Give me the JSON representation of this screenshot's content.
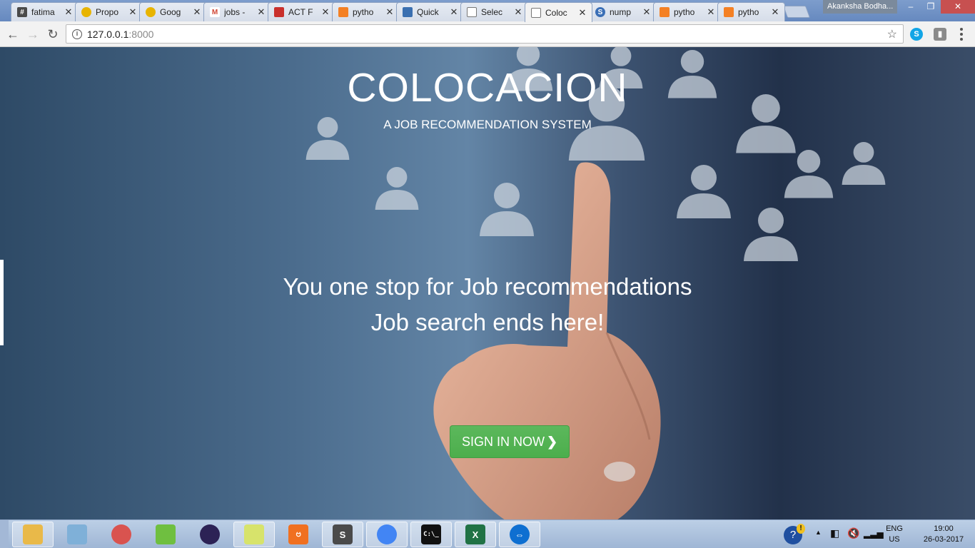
{
  "browser": {
    "tabs": [
      {
        "title": "fatima",
        "icon": "hash-icon",
        "color": "#4a4a4a"
      },
      {
        "title": "Propo",
        "icon": "coin-icon",
        "color": "#e8b400"
      },
      {
        "title": "Goog",
        "icon": "coin-icon",
        "color": "#e8b400"
      },
      {
        "title": "jobs -",
        "icon": "gmail-icon",
        "color": "#d14836"
      },
      {
        "title": "ACT F",
        "icon": "act-icon",
        "color": "#c9302c"
      },
      {
        "title": "pytho",
        "icon": "stack-icon",
        "color": "#f48024"
      },
      {
        "title": "Quick",
        "icon": "chart-icon",
        "color": "#3a6fb0"
      },
      {
        "title": "Selec",
        "icon": "page-icon",
        "color": "#777777"
      },
      {
        "title": "Coloc",
        "icon": "page-icon",
        "color": "#777777"
      },
      {
        "title": "nump",
        "icon": "s-icon",
        "color": "#3b6fb6"
      },
      {
        "title": "pytho",
        "icon": "stack-icon",
        "color": "#f48024"
      },
      {
        "title": "pytho",
        "icon": "stack-icon",
        "color": "#f48024"
      }
    ],
    "profile_name": "Akanksha Bodha...",
    "url_host": "127.0.0.1",
    "url_port": ":8000"
  },
  "page": {
    "brand": "COLOCACION",
    "tagline": "A JOB RECOMMENDATION SYSTEM",
    "headline_line1": "You one stop for Job recommendations",
    "headline_line2": "Job search ends here!",
    "signin_label": "SIGN IN NOW",
    "accent_color": "#5cb85c"
  },
  "taskbar": {
    "apps": [
      {
        "name": "explorer",
        "icon": "folder-icon",
        "color": "#e9b949",
        "glyph": ""
      },
      {
        "name": "notepad",
        "icon": "notepad-icon",
        "color": "#7fb0d8",
        "glyph": ""
      },
      {
        "name": "spinner",
        "icon": "spinner-icon",
        "color": "#d9534f",
        "glyph": ""
      },
      {
        "name": "notepadpp",
        "icon": "notepadpp-icon",
        "color": "#6fbf40",
        "glyph": ""
      },
      {
        "name": "eclipse",
        "icon": "eclipse-icon",
        "color": "#2c2255",
        "glyph": ""
      },
      {
        "name": "stickynotes",
        "icon": "stickynotes-icon",
        "color": "#d7e36b",
        "glyph": ""
      },
      {
        "name": "xampp",
        "icon": "xampp-icon",
        "color": "#f07020",
        "glyph": "ဗ"
      },
      {
        "name": "sublime",
        "icon": "sublime-icon",
        "color": "#4a4a4a",
        "glyph": "S"
      },
      {
        "name": "chrome",
        "icon": "chrome-icon",
        "color": "#4285f4",
        "glyph": ""
      },
      {
        "name": "cmd",
        "icon": "cmd-icon",
        "color": "#111111",
        "glyph": "C:\\_"
      },
      {
        "name": "excel",
        "icon": "excel-icon",
        "color": "#207245",
        "glyph": "X"
      },
      {
        "name": "teamviewer",
        "icon": "teamviewer-icon",
        "color": "#0e6fd1",
        "glyph": "⇔"
      }
    ],
    "lang": "ENG",
    "region": "US",
    "time": "19:00",
    "date": "26-03-2017"
  }
}
